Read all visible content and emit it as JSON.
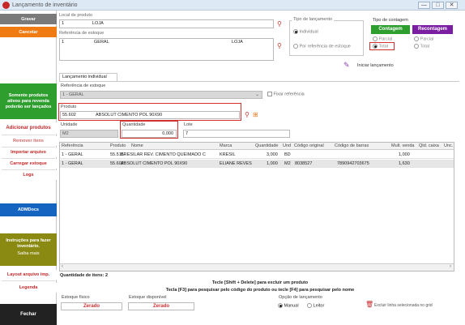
{
  "window": {
    "title": "Lançamento de inventário",
    "min": "—",
    "max": "□",
    "close": "✕"
  },
  "sidebar": {
    "gravar": "Gravar",
    "cancelar": "Cancelar",
    "somente": "Somente produtos ativos para revenda poderão ser lançados",
    "adicionar": "Adicionar produtos",
    "remover": "Remover itens",
    "importar": "Importar arquivo",
    "carregar": "Carregar estoque",
    "logs": "Logs",
    "adm": "ADMDocs",
    "instrucoes": "Instruções para fazer inventário.",
    "saiba": "Saiba mais",
    "layout": "Layout arquivo imp.",
    "legenda": "Legenda",
    "fechar": "Fechar"
  },
  "header": {
    "local_label": "Local de produto",
    "local_code": "1",
    "local_name": "LOJA",
    "ref_label": "Referência de estoque",
    "ref_code": "1",
    "ref_name": "GERAL",
    "ref_loja": "LOJA"
  },
  "tipo_lancamento": {
    "title": "Tipo de lançamento",
    "individual": "Individual",
    "por_referencia": "Por referência de estoque"
  },
  "tipo_contagem": {
    "title": "Tipo de contagem",
    "contagem": "Contagem",
    "recontagem": "Recontagem",
    "parcial": "Parcial",
    "total": "Total"
  },
  "iniciar": "Iniciar lançamento",
  "tab": "Lançamento individual",
  "form": {
    "ref_estoque_label": "Referência de estoque",
    "ref_estoque_value": "1 - GERAL",
    "fixar": "Fixar referência",
    "produto_label": "Produto",
    "produto_code": "55.602",
    "produto_name": "ABSOLUT CIMENTO POL 90X90",
    "unidade_label": "Unidade",
    "unidade_value": "M2",
    "quantidade_label": "Quantidade",
    "quantidade_value": "0,000",
    "lote_label": "Lote",
    "lote_value": "7"
  },
  "grid": {
    "headers": [
      "Referência",
      "Produto",
      "Nome",
      "Marca",
      "Quantidade",
      "Und",
      "Código original",
      "Código de barras",
      "Mult. venda",
      "Qtd. caixa",
      "Unc."
    ],
    "rows": [
      [
        "1 - GERAL",
        "55.515",
        "KRESILAR REV. CIMENTO QUEIMADO C",
        "KRESIL",
        "3,000",
        "BD",
        "",
        "",
        "1,000",
        "",
        ""
      ],
      [
        "1 - GERAL",
        "55.602",
        "ABSOLUT CIMENTO POL 90X90",
        "ELIANE REVES",
        "1,000",
        "M2",
        "8038527",
        "7890942703675",
        "1,630",
        "",
        ""
      ]
    ]
  },
  "footer": {
    "qtd_label": "Quantidade de itens:",
    "qtd_value": "2",
    "hint1": "Tecle [Shift + Delete] para excluir um produto",
    "hint2": "Tecla [F3] para pesquisar pelo código do produto ou tecle [F4] para pesquisar pelo nome",
    "estoque_fisico_label": "Estoque físico",
    "estoque_fisico_value": "Zerado",
    "estoque_disp_label": "Estoque disponível",
    "estoque_disp_value": "Zerado",
    "opcao_label": "Opção de lançamento",
    "manual": "Manual",
    "leitor": "Leitor",
    "excluir": "Excluir linha selecionada no grid"
  }
}
